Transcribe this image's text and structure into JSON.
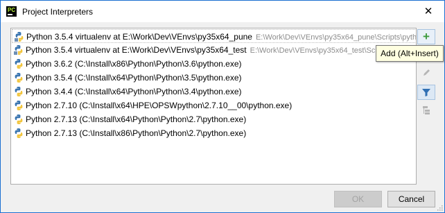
{
  "window": {
    "title": "Project Interpreters",
    "app_icon_text": "PC",
    "close_glyph": "✕"
  },
  "interpreters": [
    {
      "name": "Python 3.5.4 virtualenv at E:\\Work\\Dev\\VEnvs\\py35x64_pune",
      "path": "E:\\Work\\Dev\\VEnvs\\py35x64_pune\\Scripts\\pytho",
      "icon": "python-venv-icon"
    },
    {
      "name": "Python 3.5.4 virtualenv at E:\\Work\\Dev\\VEnvs\\py35x64_test",
      "path": "E:\\Work\\Dev\\VEnvs\\py35x64_test\\Scrip",
      "icon": "python-venv-icon"
    },
    {
      "name": "Python 3.6.2 (C:\\Install\\x86\\Python\\Python\\3.6\\python.exe)",
      "path": "",
      "icon": "python-icon"
    },
    {
      "name": "Python 3.5.4 (C:\\Install\\x64\\Python\\Python\\3.5\\python.exe)",
      "path": "",
      "icon": "python-icon"
    },
    {
      "name": "Python 3.4.4 (C:\\Install\\x64\\Python\\Python\\3.4\\python.exe)",
      "path": "",
      "icon": "python-icon"
    },
    {
      "name": "Python 2.7.10 (C:\\Install\\x64\\HPE\\OPSWpython\\2.7.10__00\\python.exe)",
      "path": "",
      "icon": "python-icon"
    },
    {
      "name": "Python 2.7.13 (C:\\Install\\x64\\Python\\Python\\2.7\\python.exe)",
      "path": "",
      "icon": "python-icon"
    },
    {
      "name": "Python 2.7.13 (C:\\Install\\x86\\Python\\Python\\2.7\\python.exe)",
      "path": "",
      "icon": "python-icon"
    }
  ],
  "toolbar": {
    "add_glyph": "+",
    "tooltip": "Add (Alt+Insert)"
  },
  "buttons": {
    "ok_label": "OK",
    "cancel_label": "Cancel"
  },
  "colors": {
    "border_accent": "#1a6fd1",
    "add_green": "#3d9a3d",
    "tooltip_bg": "#ffffe1"
  }
}
